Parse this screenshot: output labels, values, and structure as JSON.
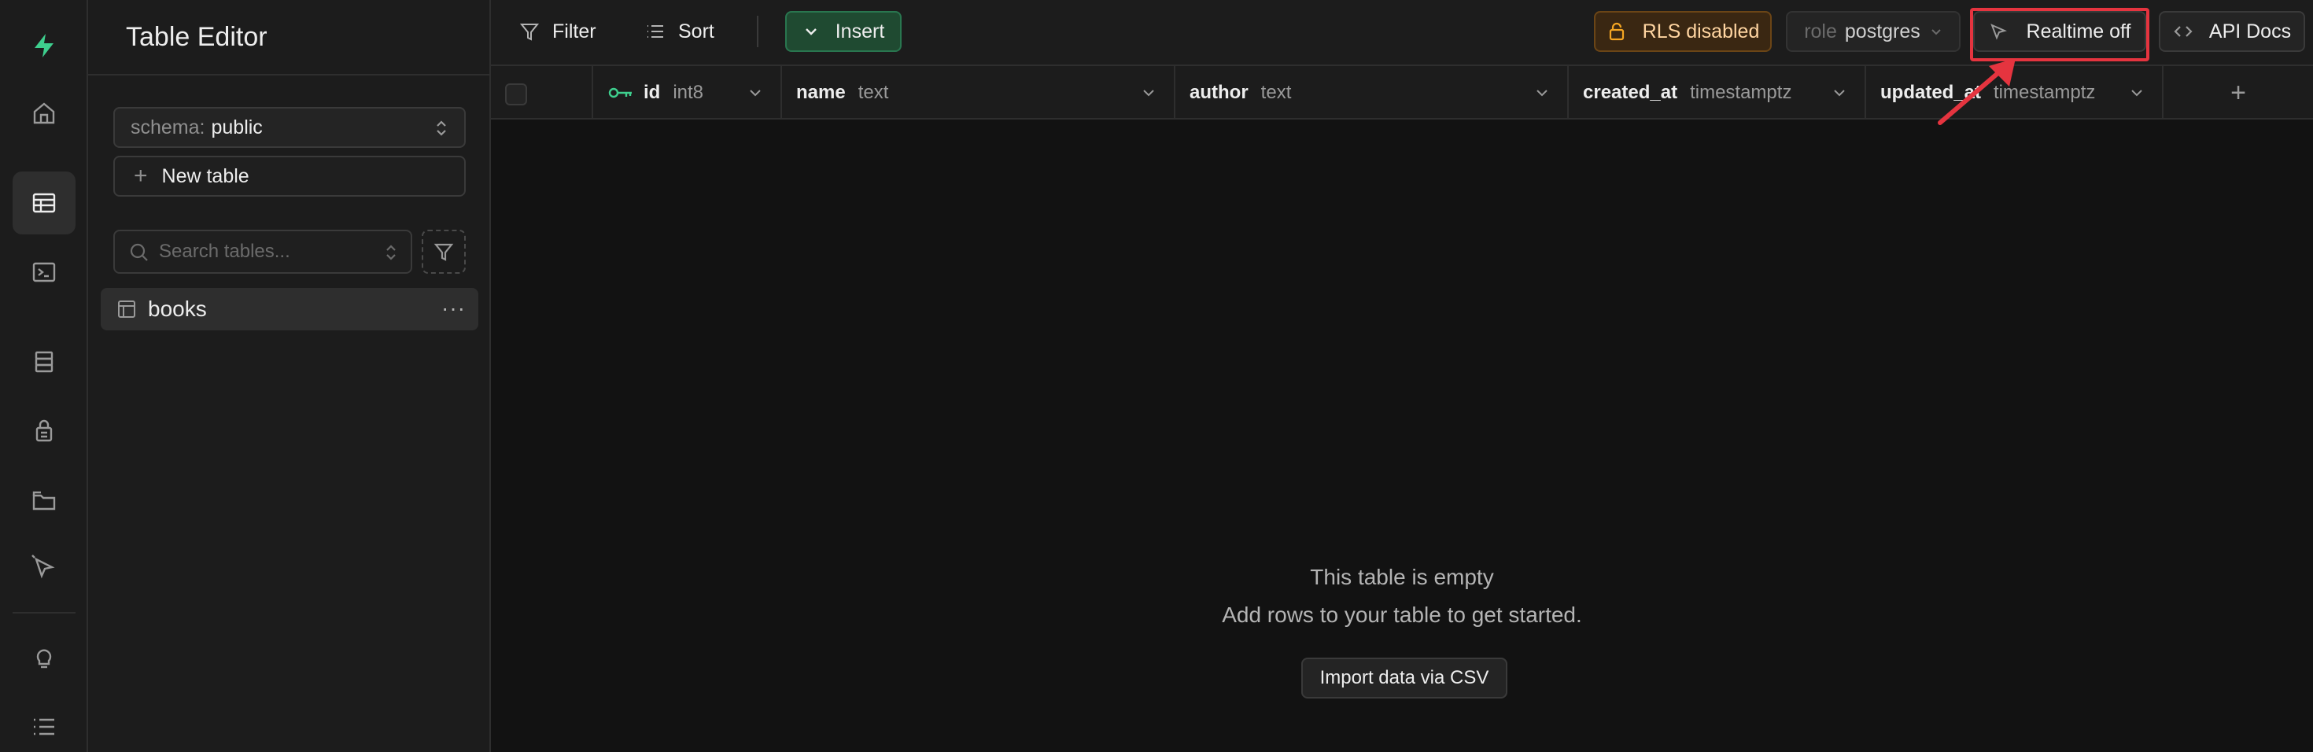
{
  "sidebar": {
    "title": "Table Editor",
    "schema_label": "schema:",
    "schema_value": "public",
    "new_table_label": "New table",
    "search_placeholder": "Search tables...",
    "tables": [
      {
        "name": "books"
      }
    ]
  },
  "toolbar": {
    "filter_label": "Filter",
    "sort_label": "Sort",
    "insert_label": "Insert",
    "rls_label": "RLS disabled",
    "role_label": "role",
    "role_value": "postgres",
    "realtime_label": "Realtime off",
    "api_docs_label": "API Docs"
  },
  "columns": [
    {
      "name": "id",
      "type": "int8",
      "primary_key": true
    },
    {
      "name": "name",
      "type": "text"
    },
    {
      "name": "author",
      "type": "text"
    },
    {
      "name": "created_at",
      "type": "timestamptz"
    },
    {
      "name": "updated_at",
      "type": "timestamptz"
    }
  ],
  "add_column_symbol": "+",
  "empty_state": {
    "title": "This table is empty",
    "subtitle": "Add rows to your table to get started.",
    "import_label": "Import data via CSV"
  },
  "colors": {
    "brand_green": "#3ecf8e",
    "highlight_red": "#e5343f",
    "rls_warning": "#ffd5a1"
  },
  "icons": {
    "rail": [
      "supabase-logo-icon",
      "home-icon",
      "table-editor-icon",
      "sql-editor-icon",
      "database-icon",
      "auth-icon",
      "storage-icon",
      "edge-functions-icon",
      "advisors-icon",
      "logs-icon"
    ]
  }
}
